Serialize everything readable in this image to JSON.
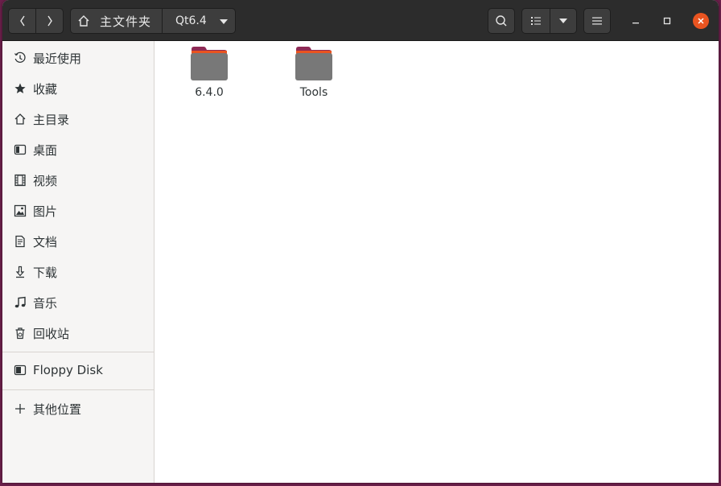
{
  "header": {
    "path": [
      "主文件夹",
      "Qt6.4"
    ]
  },
  "sidebar": {
    "items": [
      {
        "label": "最近使用",
        "icon": "clock-icon"
      },
      {
        "label": "收藏",
        "icon": "star-icon"
      },
      {
        "label": "主目录",
        "icon": "home-icon"
      },
      {
        "label": "桌面",
        "icon": "desktop-icon"
      },
      {
        "label": "视频",
        "icon": "film-icon"
      },
      {
        "label": "图片",
        "icon": "picture-icon"
      },
      {
        "label": "文档",
        "icon": "document-icon"
      },
      {
        "label": "下载",
        "icon": "download-icon"
      },
      {
        "label": "音乐",
        "icon": "music-icon"
      },
      {
        "label": "回收站",
        "icon": "trash-icon"
      }
    ],
    "devices": [
      {
        "label": "Floppy Disk",
        "icon": "floppy-icon"
      }
    ],
    "other": [
      {
        "label": "其他位置",
        "icon": "plus-icon"
      }
    ]
  },
  "content": {
    "files": [
      {
        "name": "6.4.0",
        "type": "folder"
      },
      {
        "name": "Tools",
        "type": "folder"
      }
    ]
  },
  "colors": {
    "folder_body": "#7a7a7a",
    "folder_tab": "#8e2a55",
    "folder_accent": "#e95420",
    "close_button": "#e95420",
    "headerbar": "#2c2c2c"
  }
}
